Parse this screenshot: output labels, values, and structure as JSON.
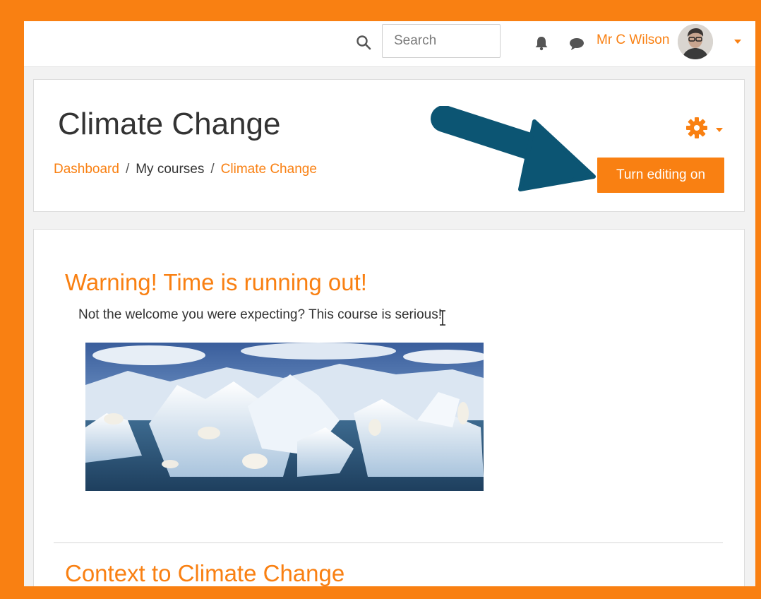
{
  "navbar": {
    "search_placeholder": "Search",
    "user_name": "Mr C Wilson",
    "icons": [
      "search-icon",
      "bell-icon",
      "chat-icon",
      "avatar",
      "caret-down-icon"
    ]
  },
  "header": {
    "title": "Climate Change",
    "breadcrumb": [
      "Dashboard",
      "My courses",
      "Climate Change"
    ],
    "edit_button": "Turn editing on",
    "icons": [
      "gear-icon",
      "caret-down-icon"
    ]
  },
  "content": {
    "section1_title": "Warning! Time is running out!",
    "section1_text": "Not the welcome you were expecting? This course is serious!",
    "section2_title": "Context to Climate Change"
  },
  "colors": {
    "accent": "#f98012",
    "arrow": "#0d5a78",
    "text": "#333333"
  }
}
